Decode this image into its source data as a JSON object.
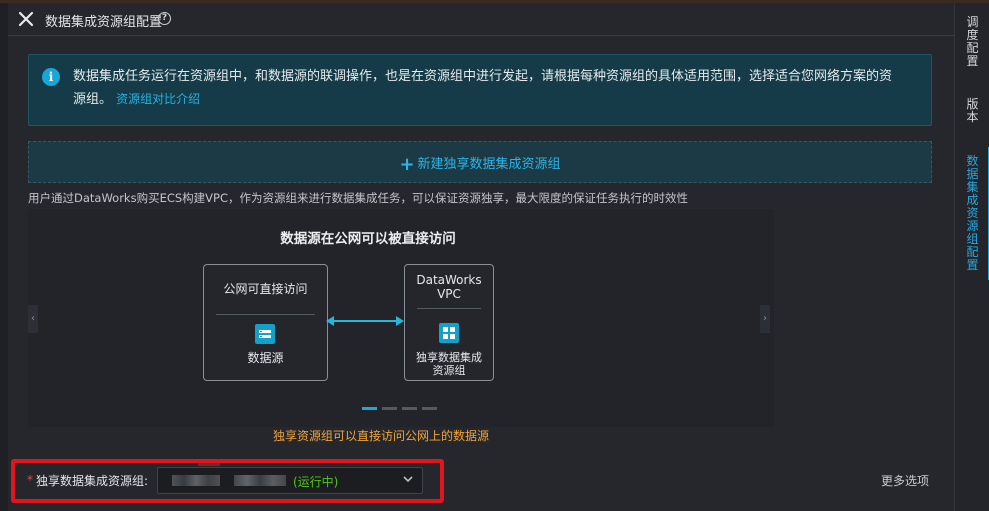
{
  "header": {
    "title": "数据集成资源组配置",
    "help_icon": "?"
  },
  "info": {
    "icon": "i",
    "text": "数据集成任务运行在资源组中，和数据源的联调操作，也是在资源组中进行发起，请根据每种资源组的具体适用范围，选择适合您网络方案的资源组。",
    "link": "资源组对比介绍"
  },
  "new_group": {
    "plus": "+",
    "label": "新建独享数据集成资源组"
  },
  "description": "用户通过DataWorks购买ECS构建VPC，作为资源组来进行数据集成任务，可以保证资源独享，最大限度的保证任务执行的时效性",
  "diagram": {
    "title": "数据源在公网可以被直接访问",
    "left_box": {
      "title": "公网可直接访问",
      "label": "数据源"
    },
    "right_box": {
      "title_line1": "DataWorks",
      "title_line2": "VPC",
      "label_line1": "独享数据集成",
      "label_line2": "资源组"
    },
    "caption": "独享资源组可以直接访问公网上的数据源",
    "prev_arrow": "‹",
    "next_arrow": "›",
    "slides_count": 4,
    "active_slide": 1
  },
  "form": {
    "required_mark": "*",
    "label": "独享数据集成资源组:",
    "status": "(运行中)",
    "more": "更多选项"
  },
  "rail": {
    "items": [
      "调度配置",
      "版本",
      "数据集成资源组配置"
    ],
    "active_index": 2
  },
  "colors": {
    "accent": "#2aa8e0",
    "highlight": "#e0161c",
    "running": "#52c41a",
    "caption": "#f1a43c"
  }
}
